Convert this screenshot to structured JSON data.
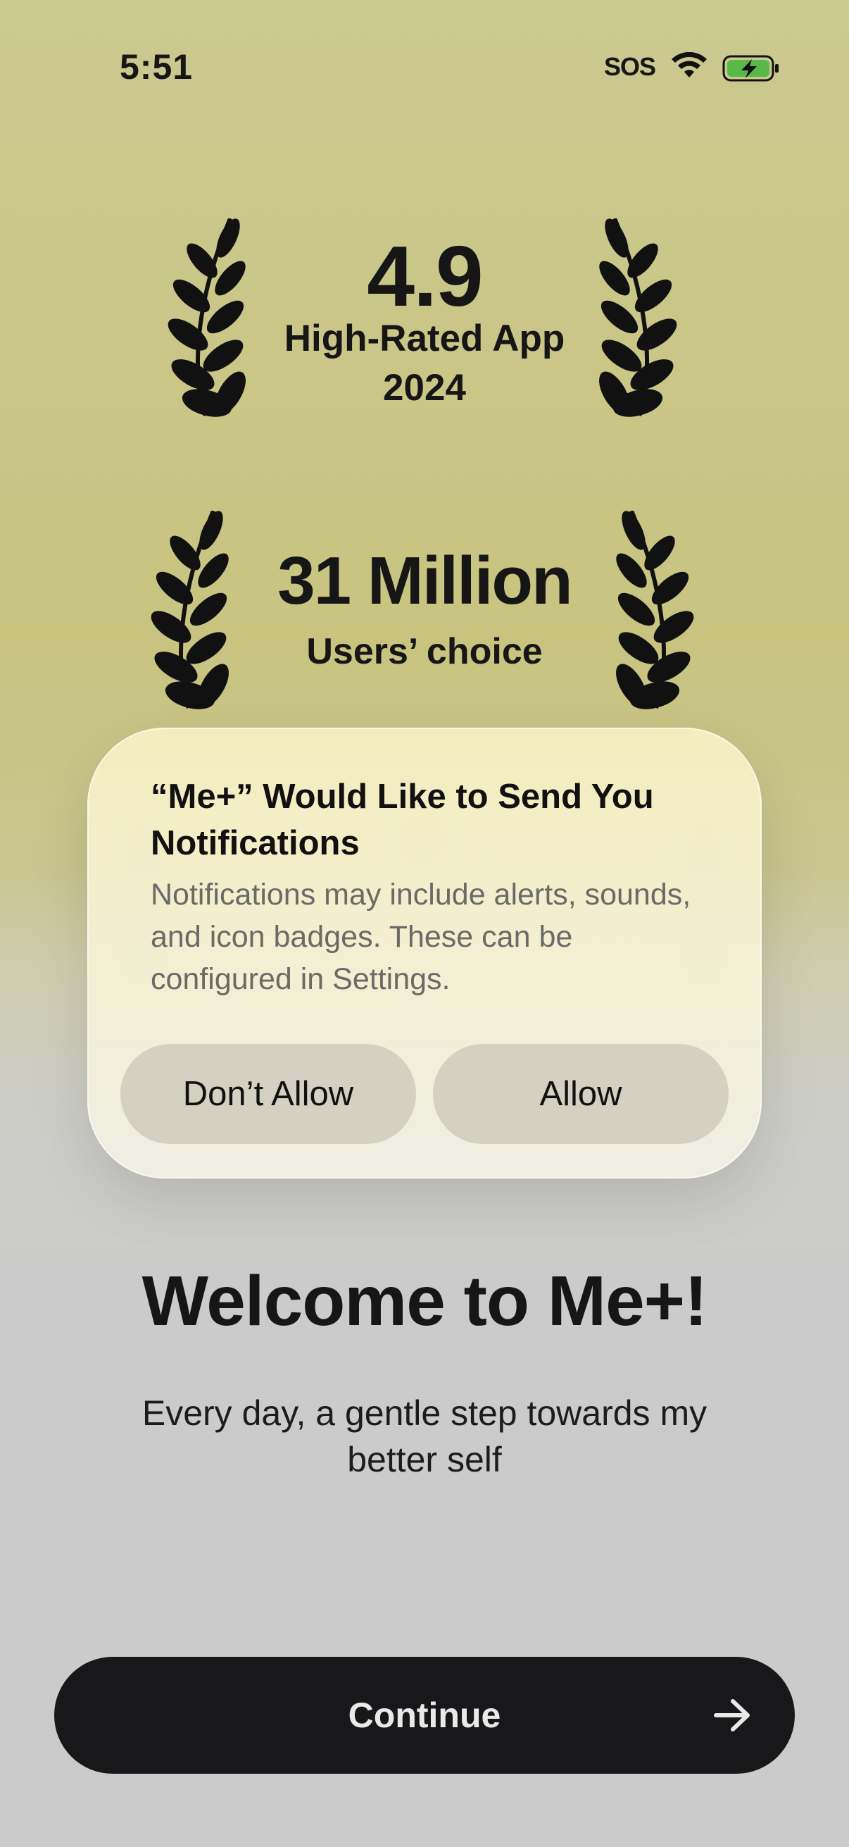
{
  "status_bar": {
    "time": "5:51",
    "carrier_status": "SOS"
  },
  "awards": [
    {
      "value": "4.9",
      "label": "High-Rated App",
      "year": "2024"
    },
    {
      "value": "31 Million",
      "label": "Users’ choice"
    }
  ],
  "dialog": {
    "title": "“Me+” Would Like to Send You Notifications",
    "body": "Notifications may include alerts, sounds, and icon badges. These can be configured in Settings.",
    "deny_label": "Don’t Allow",
    "allow_label": "Allow"
  },
  "welcome": {
    "title": "Welcome to Me+!",
    "subtitle": "Every day, a gentle step towards my better self"
  },
  "continue_button": {
    "label": "Continue"
  },
  "colors": {
    "top_background": "#c8c480",
    "bottom_background": "#cbcbcb",
    "dialog_background": "#f3efd2",
    "dialog_button": "#d4d1c3",
    "continue_button": "#18181a",
    "battery_fill": "#59b84a"
  },
  "icons": {
    "wifi": "wifi-icon",
    "battery": "battery-charging-icon",
    "laurel": "laurel-icon",
    "arrow": "arrow-right-icon"
  }
}
